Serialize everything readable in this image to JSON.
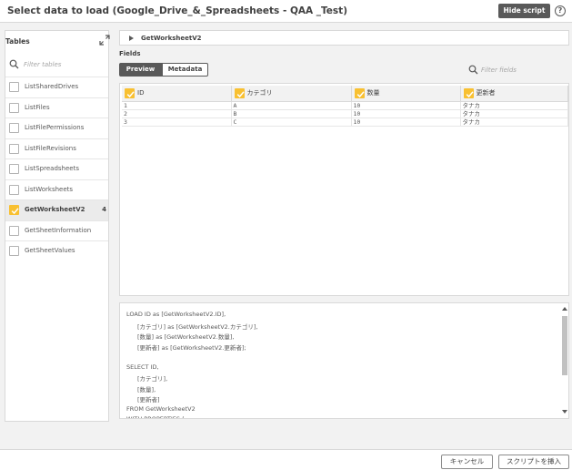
{
  "header": {
    "title": "Select data to load (Google_Drive_&_Spreadsheets - QAA _Test)",
    "hide_script_label": "Hide script",
    "help_glyph": "?"
  },
  "sidebar": {
    "title": "Tables",
    "filter_placeholder": "Filter tables",
    "items": [
      {
        "label": "ListSharedDrives",
        "checked": false,
        "selected": false,
        "count": ""
      },
      {
        "label": "ListFiles",
        "checked": false,
        "selected": false,
        "count": ""
      },
      {
        "label": "ListFilePermissions",
        "checked": false,
        "selected": false,
        "count": ""
      },
      {
        "label": "ListFileRevisions",
        "checked": false,
        "selected": false,
        "count": ""
      },
      {
        "label": "ListSpreadsheets",
        "checked": false,
        "selected": false,
        "count": ""
      },
      {
        "label": "ListWorksheets",
        "checked": false,
        "selected": false,
        "count": ""
      },
      {
        "label": "GetWorksheetV2",
        "checked": true,
        "selected": true,
        "count": "4"
      },
      {
        "label": "GetSheetInformation",
        "checked": false,
        "selected": false,
        "count": ""
      },
      {
        "label": "GetSheetValues",
        "checked": false,
        "selected": false,
        "count": ""
      }
    ]
  },
  "main": {
    "table_name": "GetWorksheetV2",
    "fields_label": "Fields",
    "tabs": {
      "preview": "Preview",
      "metadata": "Metadata"
    },
    "filter_fields_placeholder": "Filter fields",
    "columns": [
      "ID",
      "カテゴリ",
      "数量",
      "更新者"
    ],
    "rows": [
      [
        "1",
        "A",
        "10",
        "タナカ"
      ],
      [
        "2",
        "B",
        "10",
        "タナカ"
      ],
      [
        "3",
        "C",
        "10",
        "タナカ"
      ]
    ]
  },
  "script": {
    "lines": [
      {
        "text": "LOAD ID as [GetWorksheetV2.ID],",
        "indent": false
      },
      {
        "text": "[カテゴリ] as [GetWorksheetV2.カテゴリ],",
        "indent": true
      },
      {
        "text": "[数量] as [GetWorksheetV2.数量],",
        "indent": true
      },
      {
        "text": "[更新者] as [GetWorksheetV2.更新者];",
        "indent": true
      },
      {
        "text": "",
        "indent": false
      },
      {
        "text": "SELECT ID,",
        "indent": false
      },
      {
        "text": "[カテゴリ],",
        "indent": true
      },
      {
        "text": "[数量],",
        "indent": true
      },
      {
        "text": "[更新者]",
        "indent": true
      },
      {
        "text": "FROM GetWorksheetV2",
        "indent": false
      },
      {
        "text": "WITH PROPERTIES (",
        "indent": false
      }
    ]
  },
  "footer": {
    "cancel_label": "キャンセル",
    "insert_label": "スクリプトを挿入"
  },
  "colors": {
    "accent": "#f8c031",
    "dark": "#595959"
  }
}
